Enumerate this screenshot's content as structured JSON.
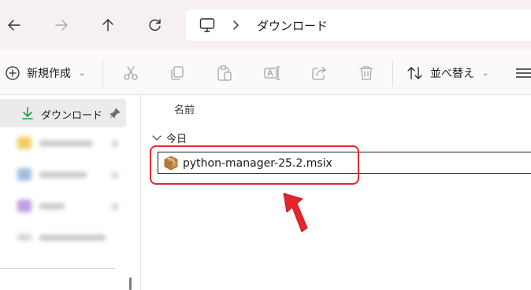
{
  "address_bar": {
    "back_icon": "arrow-left-icon",
    "forward_icon": "arrow-right-icon",
    "up_icon": "arrow-up-icon",
    "refresh_icon": "refresh-icon",
    "location_icon": "monitor-icon",
    "separator_icon": "chevron-right-icon",
    "breadcrumb": "ダウンロード"
  },
  "command_bar": {
    "new_label": "新規作成",
    "sort_label": "並べ替え",
    "tools": [
      "cut-icon",
      "copy-icon",
      "paste-icon",
      "rename-icon",
      "share-icon",
      "delete-icon"
    ]
  },
  "sidebar": {
    "active_item": "ダウンロード"
  },
  "content": {
    "column_name": "名前",
    "group_label": "今日",
    "file_name": "python-manager-25.2.msix"
  },
  "colors": {
    "highlight": "#e8242b",
    "download_icon": "#1a9e4a",
    "address_bar_bg": "#f6f0f3"
  }
}
